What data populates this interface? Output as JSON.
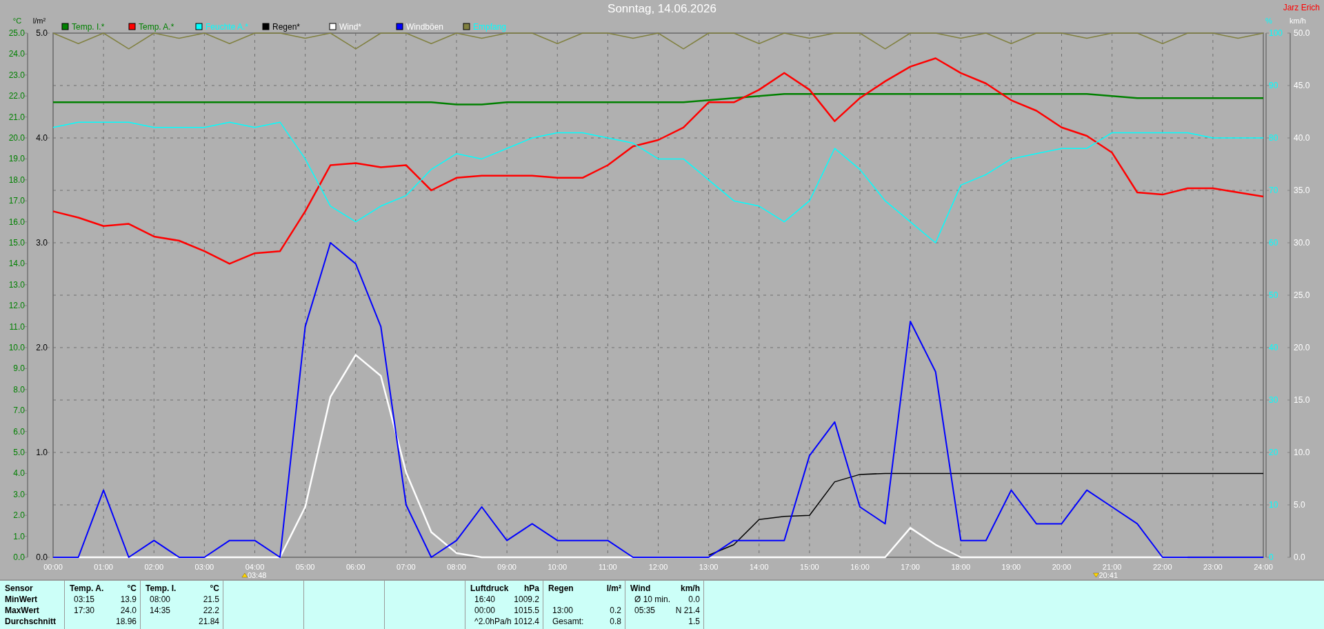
{
  "chart": {
    "author": "Jarz Erich",
    "sun_events": [
      {
        "kind": "sunrise",
        "time": "03:48"
      },
      {
        "kind": "sunset",
        "time": "20:41"
      }
    ],
    "layers": [
      {
        "chart_data": {
          "type": "line",
          "legend": "top",
          "title": "Sonntag, 14.06.2026",
          "ylabel": "°C",
          "xlim": [
            0,
            24
          ],
          "ylim": [
            0,
            25
          ],
          "x": [
            0,
            0.5,
            1,
            1.5,
            2,
            2.5,
            3,
            3.5,
            4,
            4.5,
            5,
            5.5,
            6,
            6.5,
            7,
            7.5,
            8,
            8.5,
            9,
            9.5,
            10,
            10.5,
            11,
            11.5,
            12,
            12.5,
            13,
            13.5,
            14,
            14.5,
            15,
            15.5,
            16,
            16.5,
            17,
            17.5,
            18,
            18.5,
            19,
            19.5,
            20,
            20.5,
            21,
            21.5,
            22,
            22.5,
            23,
            23.5,
            24
          ],
          "xticks": [
            {
              "value": 0,
              "label": "00:00"
            },
            {
              "value": 1,
              "label": "01:00"
            },
            {
              "value": 2,
              "label": "02:00"
            },
            {
              "value": 3,
              "label": "03:00"
            },
            {
              "value": 4,
              "label": "04:00"
            },
            {
              "value": 5,
              "label": "05:00"
            },
            {
              "value": 6,
              "label": "06:00"
            },
            {
              "value": 7,
              "label": "07:00"
            },
            {
              "value": 8,
              "label": "08:00"
            },
            {
              "value": 9,
              "label": "09:00"
            },
            {
              "value": 10,
              "label": "10:00"
            },
            {
              "value": 11,
              "label": "11:00"
            },
            {
              "value": 12,
              "label": "12:00"
            },
            {
              "value": 13,
              "label": "13:00"
            },
            {
              "value": 14,
              "label": "14:00"
            },
            {
              "value": 15,
              "label": "15:00"
            },
            {
              "value": 16,
              "label": "16:00"
            },
            {
              "value": 17,
              "label": "17:00"
            },
            {
              "value": 18,
              "label": "18:00"
            },
            {
              "value": 19,
              "label": "19:00"
            },
            {
              "value": 20,
              "label": "20:00"
            },
            {
              "value": 21,
              "label": "21:00"
            },
            {
              "value": 22,
              "label": "22:00"
            },
            {
              "value": 23,
              "label": "23:00"
            },
            {
              "value": 24,
              "label": "24:00"
            }
          ],
          "yticks": [
            {
              "value": 0,
              "label": "0.0"
            },
            {
              "value": 1,
              "label": "1.0"
            },
            {
              "value": 2,
              "label": "2.0"
            },
            {
              "value": 3,
              "label": "3.0"
            },
            {
              "value": 4,
              "label": "4.0"
            },
            {
              "value": 5,
              "label": "5.0"
            },
            {
              "value": 6,
              "label": "6.0"
            },
            {
              "value": 7,
              "label": "7.0"
            },
            {
              "value": 8,
              "label": "8.0"
            },
            {
              "value": 9,
              "label": "9.0"
            },
            {
              "value": 10,
              "label": "10.0"
            },
            {
              "value": 11,
              "label": "11.0"
            },
            {
              "value": 12,
              "label": "12.0"
            },
            {
              "value": 13,
              "label": "13.0"
            },
            {
              "value": 14,
              "label": "14.0"
            },
            {
              "value": 15,
              "label": "15.0"
            },
            {
              "value": 16,
              "label": "16.0"
            },
            {
              "value": 17,
              "label": "17.0"
            },
            {
              "value": 18,
              "label": "18.0"
            },
            {
              "value": 19,
              "label": "19.0"
            },
            {
              "value": 20,
              "label": "20.0"
            },
            {
              "value": 21,
              "label": "21.0"
            },
            {
              "value": 22,
              "label": "22.0"
            },
            {
              "value": 23,
              "label": "23.0"
            },
            {
              "value": 24,
              "label": "24.0"
            },
            {
              "value": 25,
              "label": "25.0"
            }
          ],
          "y2label": "%",
          "y2lim": [
            0,
            100
          ],
          "y2ticks": [
            {
              "value": 0,
              "label": "0"
            },
            {
              "value": 10,
              "label": "10"
            },
            {
              "value": 20,
              "label": "20"
            },
            {
              "value": 30,
              "label": "30"
            },
            {
              "value": 40,
              "label": "40"
            },
            {
              "value": 50,
              "label": "50"
            },
            {
              "value": 60,
              "label": "60"
            },
            {
              "value": 70,
              "label": "70"
            },
            {
              "value": 80,
              "label": "80"
            },
            {
              "value": 90,
              "label": "90"
            },
            {
              "value": 100,
              "label": "100"
            }
          ],
          "y3label": "l/m²",
          "y3lim": [
            0,
            5
          ],
          "y3ticks": [
            {
              "value": 0,
              "label": "0.0"
            },
            {
              "value": 1,
              "label": "1.0"
            },
            {
              "value": 2,
              "label": "2.0"
            },
            {
              "value": 3,
              "label": "3.0"
            },
            {
              "value": 4,
              "label": "4.0"
            },
            {
              "value": 5,
              "label": "5.0"
            }
          ],
          "series": [
            {
              "name": "Temp. I.*",
              "color": "#008000",
              "values": [
                21.7,
                21.7,
                21.7,
                21.7,
                21.7,
                21.7,
                21.7,
                21.7,
                21.7,
                21.7,
                21.7,
                21.7,
                21.7,
                21.7,
                21.7,
                21.7,
                21.6,
                21.6,
                21.7,
                21.7,
                21.7,
                21.7,
                21.7,
                21.7,
                21.7,
                21.7,
                21.8,
                21.9,
                22.0,
                22.1,
                22.1,
                22.1,
                22.1,
                22.1,
                22.1,
                22.1,
                22.1,
                22.1,
                22.1,
                22.1,
                22.1,
                22.1,
                22.0,
                21.9,
                21.9,
                21.9,
                21.9,
                21.9,
                21.9
              ]
            },
            {
              "name": "Temp. A.*",
              "color": "#ff0000",
              "values": [
                16.5,
                16.2,
                15.8,
                15.9,
                15.3,
                15.1,
                14.6,
                14.0,
                14.5,
                14.6,
                16.5,
                18.7,
                18.8,
                18.6,
                18.7,
                17.5,
                18.1,
                18.2,
                18.2,
                18.2,
                18.1,
                18.1,
                18.7,
                19.6,
                19.9,
                20.5,
                21.7,
                21.7,
                22.3,
                23.1,
                22.3,
                20.8,
                21.9,
                22.7,
                23.4,
                23.8,
                23.1,
                22.6,
                21.8,
                21.3,
                20.5,
                20.1,
                19.3,
                17.4,
                17.3,
                17.6,
                17.6,
                17.4,
                17.2
              ]
            },
            {
              "name": "Feuchte A.*",
              "color": "#00ffff",
              "axis": "y2",
              "values": [
                82,
                83,
                83,
                83,
                82,
                82,
                82,
                83,
                82,
                83,
                76,
                67,
                64,
                67,
                69,
                74,
                77,
                76,
                78,
                80,
                81,
                81,
                80,
                79,
                76,
                76,
                72,
                68,
                67,
                64,
                68,
                78,
                74,
                68,
                64,
                60,
                71,
                73,
                76,
                77,
                78,
                78,
                81,
                81,
                81,
                81,
                80,
                80,
                80
              ]
            },
            {
              "name": "Regen*",
              "color": "#000000",
              "axis": "y3",
              "values": [
                null,
                null,
                null,
                null,
                null,
                null,
                null,
                null,
                null,
                null,
                null,
                null,
                null,
                null,
                null,
                null,
                null,
                null,
                null,
                null,
                null,
                null,
                null,
                null,
                null,
                null,
                0.02,
                0.12,
                0.36,
                0.39,
                0.4,
                0.72,
                0.79,
                0.8,
                0.8,
                0.8,
                0.8,
                0.8,
                0.8,
                0.8,
                0.8,
                0.8,
                0.8,
                0.8,
                0.8,
                0.8,
                0.8,
                0.8,
                0.8
              ]
            }
          ]
        }
      },
      {
        "chart_data": {
          "type": "line",
          "legend": "top",
          "ylabel": "km/h",
          "xlim": [
            0,
            24
          ],
          "ylim": [
            0,
            50
          ],
          "x": [
            0,
            0.5,
            1,
            1.5,
            2,
            2.5,
            3,
            3.5,
            4,
            4.5,
            5,
            5.5,
            6,
            6.5,
            7,
            7.5,
            8,
            8.5,
            9,
            9.5,
            10,
            10.5,
            11,
            11.5,
            12,
            12.5,
            13,
            13.5,
            14,
            14.5,
            15,
            15.5,
            16,
            16.5,
            17,
            17.5,
            18,
            18.5,
            19,
            19.5,
            20,
            20.5,
            21,
            21.5,
            22,
            22.5,
            23,
            23.5,
            24
          ],
          "yticks": [
            {
              "value": 0,
              "label": "0.0"
            },
            {
              "value": 5,
              "label": "5.0"
            },
            {
              "value": 10,
              "label": "10.0"
            },
            {
              "value": 15,
              "label": "15.0"
            },
            {
              "value": 20,
              "label": "20.0"
            },
            {
              "value": 25,
              "label": "25.0"
            },
            {
              "value": 30,
              "label": "30.0"
            },
            {
              "value": 35,
              "label": "35.0"
            },
            {
              "value": 40,
              "label": "40.0"
            },
            {
              "value": 45,
              "label": "45.0"
            },
            {
              "value": 50,
              "label": "50.0"
            }
          ],
          "y2lim": [
            0,
            100
          ],
          "series": [
            {
              "name": "Wind*",
              "color": "#ffffff",
              "values": [
                0,
                0,
                0,
                0,
                0,
                0,
                0,
                0,
                0,
                0,
                4.8,
                15.3,
                19.3,
                17.3,
                8.1,
                2.4,
                0.4,
                0,
                0,
                0,
                0,
                0,
                0,
                0,
                0,
                0,
                0,
                0,
                0,
                0,
                0,
                0,
                0,
                0,
                2.8,
                1.2,
                0,
                0,
                0,
                0,
                0,
                0,
                0,
                0,
                0,
                0,
                null,
                null,
                null
              ]
            },
            {
              "name": "Windböen",
              "color": "#0000ff",
              "values": [
                0,
                0,
                6.4,
                0,
                1.6,
                0,
                0,
                1.6,
                1.6,
                0,
                22,
                30,
                28,
                22,
                5,
                0,
                1.6,
                4.8,
                1.6,
                3.2,
                1.6,
                1.6,
                1.6,
                0,
                0,
                0,
                0,
                1.6,
                1.6,
                1.6,
                9.7,
                12.9,
                4.8,
                3.2,
                22.5,
                17.7,
                1.6,
                1.6,
                6.4,
                3.2,
                3.2,
                6.4,
                4.8,
                3.2,
                0,
                0,
                0,
                0,
                0
              ]
            },
            {
              "name": "Empfang",
              "color": "#808040",
              "axis": "y2",
              "values": [
                100,
                98,
                100,
                97,
                100,
                99,
                100,
                98,
                100,
                100,
                99,
                100,
                97,
                100,
                100,
                98,
                100,
                99,
                100,
                100,
                98,
                100,
                100,
                99,
                100,
                97,
                100,
                100,
                98,
                100,
                99,
                100,
                100,
                97,
                100,
                100,
                99,
                100,
                98,
                100,
                100,
                99,
                100,
                100,
                98,
                100,
                100,
                99,
                100
              ]
            }
          ]
        }
      }
    ]
  },
  "stats": {
    "header": "Sensor",
    "columns": [
      {
        "label": "Temp. A.",
        "unit": "°C"
      },
      {
        "label": "Temp. I.",
        "unit": "°C"
      },
      {
        "label": "Luftdruck",
        "unit": "hPa"
      },
      {
        "label": "Regen",
        "unit": "l/m²"
      },
      {
        "label": "Wind",
        "unit": "km/h"
      }
    ],
    "rows": [
      {
        "label": "MinWert",
        "cells": [
          {
            "time": "03:15",
            "value": "13.9"
          },
          {
            "time": "08:00",
            "value": "21.5"
          },
          {
            "time": "16:40",
            "value": "1009.2"
          },
          null,
          {
            "time": "Ø 10 min.",
            "value": "0.0"
          }
        ]
      },
      {
        "label": "MaxWert",
        "cells": [
          {
            "time": "17:30",
            "value": "24.0"
          },
          {
            "time": "14:35",
            "value": "22.2"
          },
          {
            "time": "00:00",
            "value": "1015.5"
          },
          {
            "time": "13:00",
            "value": "0.2"
          },
          {
            "time": "05:35",
            "value": "N 21.4"
          }
        ]
      },
      {
        "label": "Durchschnitt",
        "cells": [
          {
            "value": "18.96"
          },
          {
            "value": "21.84"
          },
          {
            "time": "^2.0hPa/h",
            "value": "1012.4"
          },
          {
            "time": "Gesamt:",
            "value": "0.8"
          },
          {
            "value": "1.5"
          }
        ]
      }
    ]
  }
}
